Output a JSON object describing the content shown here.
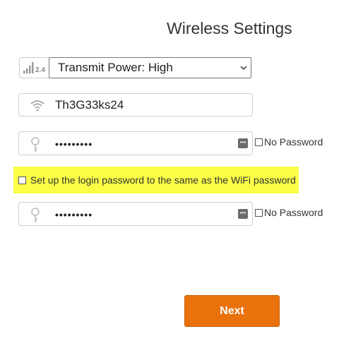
{
  "header": {
    "title": "Wireless Settings"
  },
  "transmit_power": {
    "icon": "signal-bars-icon",
    "band_label": "2.4",
    "selected": "Transmit Power: High"
  },
  "ssid": {
    "icon": "wifi-icon",
    "value": "Th3G33ks24"
  },
  "wifi_password": {
    "icon": "key-icon",
    "masked_value": "•••••••••",
    "no_password_label": "No Password",
    "no_password_checked": false
  },
  "sync_option": {
    "label": "Set up the login password to the same as the WiFi password",
    "checked": false,
    "highlight_color": "#fbff46"
  },
  "login_password": {
    "icon": "key-icon",
    "masked_value": "•••••••••",
    "no_password_label": "No Password",
    "no_password_checked": false
  },
  "actions": {
    "next_label": "Next",
    "next_color": "#e9720d"
  }
}
